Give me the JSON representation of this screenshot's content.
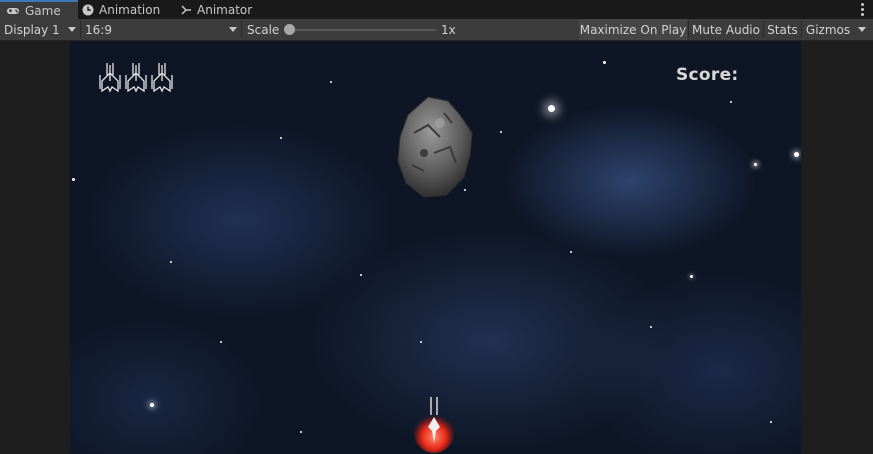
{
  "tabs": [
    {
      "label": "Game",
      "icon": "gamepad-icon",
      "active": true
    },
    {
      "label": "Animation",
      "icon": "animation-clock-icon",
      "active": false
    },
    {
      "label": "Animator",
      "icon": "animator-graph-icon",
      "active": false
    }
  ],
  "toolbar": {
    "display": "Display 1",
    "aspect": "16:9",
    "scale_label": "Scale",
    "scale_value": "1x",
    "maximize": "Maximize On Play",
    "mute": "Mute Audio",
    "stats": "Stats",
    "gizmos": "Gizmos"
  },
  "game": {
    "score_label": "Score:",
    "lives": 3
  }
}
